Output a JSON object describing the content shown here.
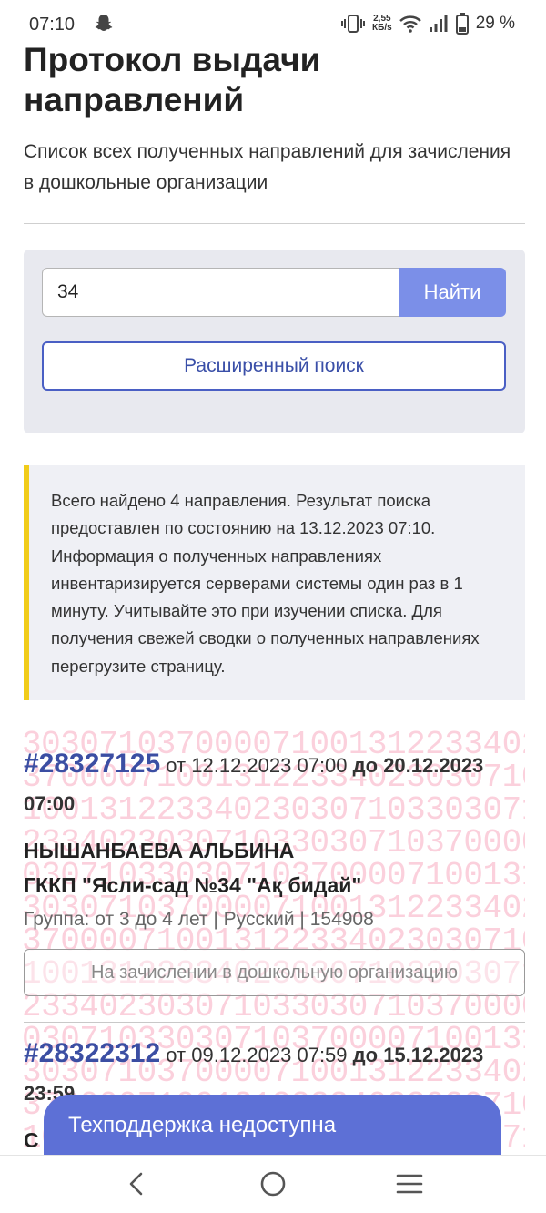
{
  "status_bar": {
    "time": "07:10",
    "net_speed_value": "2,55",
    "net_speed_unit": "КБ/s",
    "battery": "29 %",
    "icons": [
      "snapchat-icon",
      "vibrate-icon",
      "wifi-icon",
      "signal-icon",
      "battery-icon"
    ]
  },
  "header": {
    "title": "Протокол выдачи направлений",
    "subtitle": "Список всех полученных направлений для зачисления в дошкольные организации"
  },
  "search": {
    "value": "34",
    "button_label": "Найти",
    "advanced_label": "Расширенный поиск"
  },
  "info": {
    "text": "Всего найдено 4 направления. Результат поиска предоставлен по состоянию на 13.12.2023 07:10. Информация о полученных направлениях инвентаризируется серверами системы один раз в 1 минуту. Учитывайте это при изучении списка. Для получения свежей сводки о полученных направлениях перегрузите страницу."
  },
  "watermark_text": "30307103700007100131223340230307103",
  "results": [
    {
      "id": "#28327125",
      "from_label": "от",
      "from_date": "12.12.2023 07:00",
      "to_label": "до",
      "to_date": "20.12.2023 07:00",
      "name": "НЫШАНБАЕВА АЛЬБИНА",
      "org": "ГККП \"Ясли-сад №34 \"Ақ бидай\"",
      "group": "Группа: от 3 до 4 лет | Русский | 154908",
      "status": "На зачислении в дошкольную организацию"
    },
    {
      "id": "#28322312",
      "from_label": "от",
      "from_date": "09.12.2023 07:59",
      "to_label": "до",
      "to_date": "15.12.2023 23:59",
      "name": "С"
    }
  ],
  "support": {
    "label": "Техподдержка недоступна"
  },
  "nav": {
    "icons": [
      "back-icon",
      "home-icon",
      "recents-icon"
    ]
  }
}
